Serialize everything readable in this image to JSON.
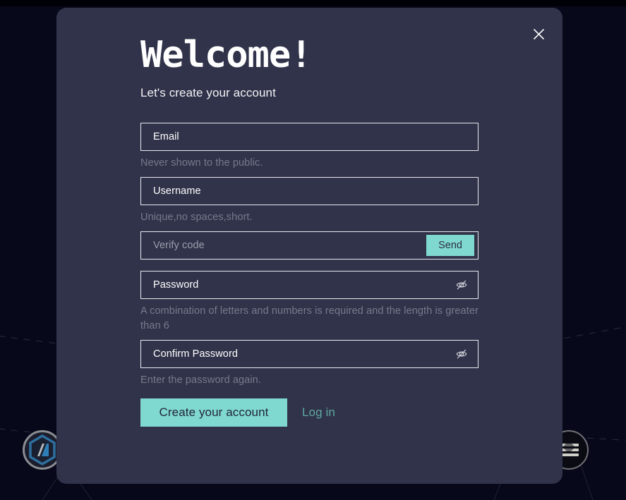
{
  "background": {
    "page_bg": "#07081a",
    "topbar_color": "#000007",
    "line_color": "#1c2133",
    "badges": [
      {
        "name": "hexagon-logo-badge",
        "position": "bottom-left"
      },
      {
        "name": "circular-logo-badge",
        "position": "bottom-right"
      }
    ]
  },
  "modal": {
    "bg_color": "#31334a",
    "title": "Welcome!",
    "subtitle": "Let's create your account",
    "close_icon": "close-icon",
    "fields": [
      {
        "name": "email",
        "label": "Email",
        "value": "",
        "placeholder": "Email",
        "hint": "Never shown to the public.",
        "muted": false
      },
      {
        "name": "username",
        "label": "Username",
        "value": "",
        "placeholder": "Username",
        "hint": "Unique,no spaces,short.",
        "muted": false
      },
      {
        "name": "verify-code",
        "label": "Verify code",
        "value": "",
        "placeholder": "Verify code",
        "hint": "",
        "muted": true,
        "action_label": "Send"
      },
      {
        "name": "password",
        "label": "Password",
        "value": "",
        "placeholder": "Password",
        "hint": "A combination of letters and numbers is required and the length is greater than 6",
        "muted": false,
        "toggle_icon": "eye-off-icon"
      },
      {
        "name": "confirm-password",
        "label": "Confirm Password",
        "value": "",
        "placeholder": "Confirm Password",
        "hint": "Enter the password again.",
        "muted": false,
        "toggle_icon": "eye-off-icon"
      }
    ],
    "actions": {
      "submit_label": "Create your account",
      "login_label": "Log in",
      "submit_bg": "#7fd9d0",
      "login_color": "#5fa8a2"
    }
  }
}
